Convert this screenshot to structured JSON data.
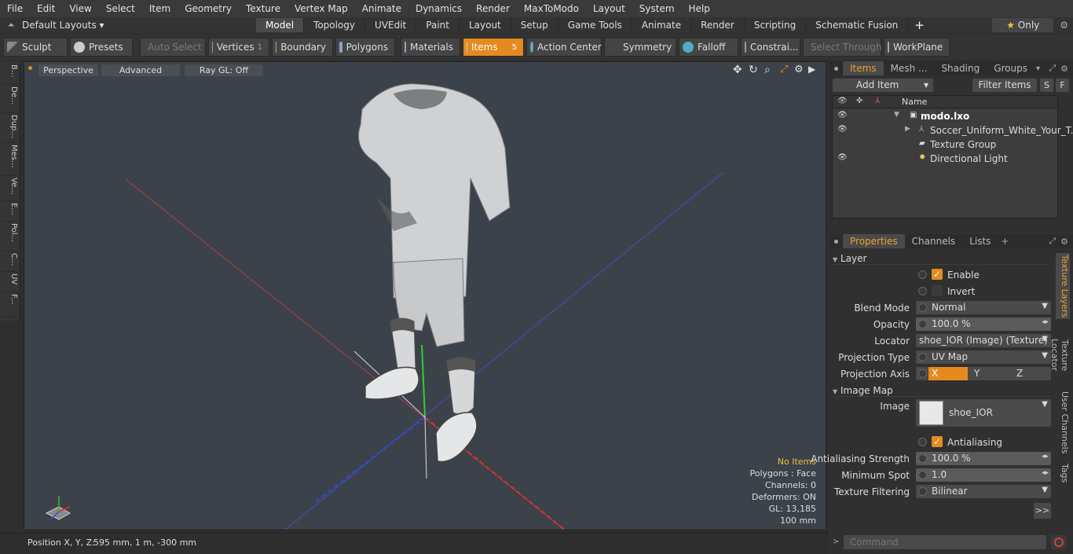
{
  "menu": [
    "File",
    "Edit",
    "View",
    "Select",
    "Item",
    "Geometry",
    "Texture",
    "Vertex Map",
    "Animate",
    "Dynamics",
    "Render",
    "MaxToModo",
    "Layout",
    "System",
    "Help"
  ],
  "layout_selector": "Default Layouts",
  "layout_tabs": [
    "Model",
    "Topology",
    "UVEdit",
    "Paint",
    "Layout",
    "Setup",
    "Game Tools",
    "Animate",
    "Render",
    "Scripting",
    "Schematic Fusion"
  ],
  "active_layout_tab": "Model",
  "only_label": "Only",
  "toolbar": {
    "sculpt": "Sculpt",
    "presets": "Presets",
    "auto_select": "Auto Select",
    "vertices": "Vertices",
    "vertices_count": "1",
    "boundary": "Boundary",
    "polygons": "Polygons",
    "materials": "Materials",
    "items": "Items",
    "items_count": "5",
    "action_center": "Action Center",
    "symmetry": "Symmetry",
    "falloff": "Falloff",
    "constraints": "Constrai...",
    "select_through": "Select Through",
    "workplane": "WorkPlane"
  },
  "left_tabs": [
    "B...",
    "De...",
    "Dup...",
    "Mes...",
    "Ve...",
    "E...",
    "Pol...",
    "C...",
    "UV",
    "F..."
  ],
  "viewport": {
    "view_mode": "Perspective",
    "advanced": "Advanced",
    "raygl": "Ray GL: Off",
    "info": {
      "selection": "No Items",
      "polygons": "Polygons : Face",
      "channels": "Channels: 0",
      "deformers": "Deformers: ON",
      "gl": "GL: 13,185",
      "unit": "100 mm"
    },
    "selection_color": "#f0c040"
  },
  "status": {
    "position_label": "Position X, Y, Z:",
    "position_value": "595 mm, 1 m, -300 mm"
  },
  "items_panel": {
    "tabs": [
      "Items",
      "Mesh ...",
      "Shading",
      "Groups"
    ],
    "add_item": "Add Item",
    "filter_items": "Filter Items",
    "s_button": "S",
    "f_button": "F",
    "name_header": "Name",
    "tree": [
      {
        "label": "modo.lxo",
        "indent": 0
      },
      {
        "label": "Soccer_Uniform_White_Your_T...",
        "indent": 1
      },
      {
        "label": "Texture Group",
        "indent": 1
      },
      {
        "label": "Directional Light",
        "indent": 1
      }
    ]
  },
  "props_panel": {
    "tabs": [
      "Properties",
      "Channels",
      "Lists"
    ],
    "side_tabs": [
      "Texture Layers",
      "Texture Locator",
      "User Channels",
      "Tags"
    ],
    "layer_section": "Layer",
    "enable": "Enable",
    "invert": "Invert",
    "blend_mode_label": "Blend Mode",
    "blend_mode": "Normal",
    "opacity_label": "Opacity",
    "opacity": "100.0 %",
    "locator_label": "Locator",
    "locator": "shoe_IOR (Image) (Texture)",
    "projection_type_label": "Projection Type",
    "projection_type": "UV Map",
    "projection_axis_label": "Projection Axis",
    "axes": [
      "X",
      "Y",
      "Z"
    ],
    "image_map_section": "Image Map",
    "image_label": "Image",
    "image_name": "shoe_IOR",
    "antialiasing": "Antialiasing",
    "aa_strength_label": "Antialiasing Strength",
    "aa_strength": "100.0 %",
    "min_spot_label": "Minimum Spot",
    "min_spot": "1.0",
    "tex_filter_label": "Texture Filtering",
    "tex_filter": "Bilinear",
    "more": ">>"
  },
  "command_placeholder": "Command",
  "accent": "#e58a1f"
}
